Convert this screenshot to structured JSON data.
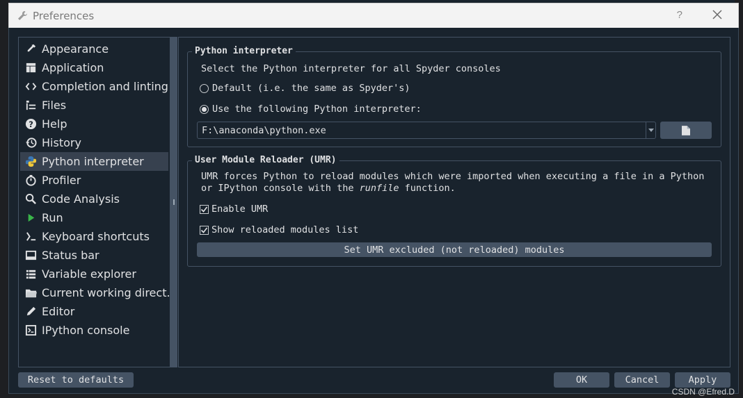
{
  "window": {
    "title": "Preferences",
    "help_label": "?"
  },
  "sidebar": {
    "items": [
      {
        "label": "Appearance",
        "icon": "eyedropper-icon"
      },
      {
        "label": "Application",
        "icon": "layout-icon"
      },
      {
        "label": "Completion and linting",
        "icon": "code-icon"
      },
      {
        "label": "Files",
        "icon": "file-tree-icon"
      },
      {
        "label": "Help",
        "icon": "question-icon"
      },
      {
        "label": "History",
        "icon": "history-icon"
      },
      {
        "label": "Python interpreter",
        "icon": "python-icon"
      },
      {
        "label": "Profiler",
        "icon": "timer-icon"
      },
      {
        "label": "Code Analysis",
        "icon": "search-code-icon"
      },
      {
        "label": "Run",
        "icon": "play-icon"
      },
      {
        "label": "Keyboard shortcuts",
        "icon": "keyboard-icon"
      },
      {
        "label": "Status bar",
        "icon": "statusbar-icon"
      },
      {
        "label": "Variable explorer",
        "icon": "list-icon"
      },
      {
        "label": "Current working direct...",
        "icon": "folder-icon"
      },
      {
        "label": "Editor",
        "icon": "pencil-icon"
      },
      {
        "label": "IPython console",
        "icon": "console-icon"
      }
    ],
    "selected": "Python interpreter"
  },
  "python_interpreter": {
    "group_title": "Python interpreter",
    "description": "Select the Python interpreter for all Spyder consoles",
    "default_label": "Default (i.e. the same as Spyder's)",
    "custom_label": "Use the following Python interpreter:",
    "selected_option": "custom",
    "path_value": "F:\\anaconda\\python.exe"
  },
  "umr": {
    "group_title": "User Module Reloader (UMR)",
    "description_line1": "UMR forces Python to reload modules which were imported when executing a file in a Python",
    "description_line2_prefix": "or IPython console with the ",
    "description_line2_italic": "runfile",
    "description_line2_suffix": " function.",
    "enable_label": "Enable UMR",
    "enable_checked": true,
    "show_list_label": "Show reloaded modules list",
    "show_list_checked": true,
    "excluded_button": "Set UMR excluded (not reloaded) modules"
  },
  "footer": {
    "reset_label": "Reset to defaults",
    "ok_label": "OK",
    "cancel_label": "Cancel",
    "apply_label": "Apply"
  },
  "watermark": "CSDN @Efred.D",
  "colors": {
    "background": "#19232d",
    "border": "#455364",
    "selected": "#37414f",
    "text": "#e0e1e3"
  }
}
